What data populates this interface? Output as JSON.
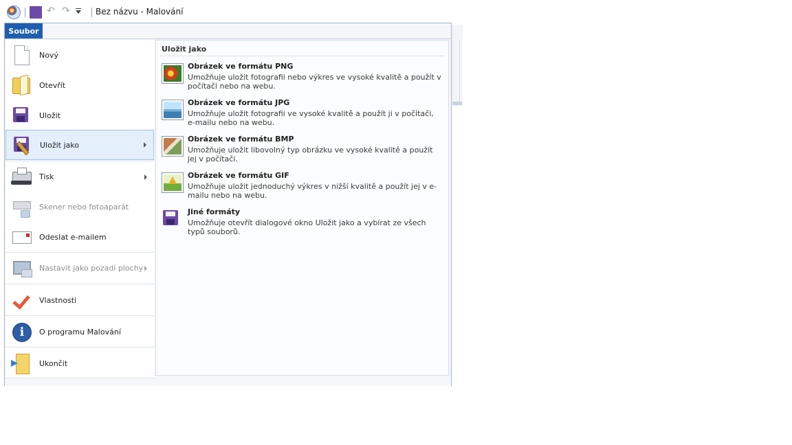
{
  "window": {
    "title": "Bez názvu - Malování"
  },
  "quick_access": {
    "icons": [
      "paint-app-icon",
      "save-icon",
      "undo-icon",
      "redo-icon",
      "customize-dropdown-icon"
    ]
  },
  "ribbon": {
    "file_tab_label": "Soubor",
    "accent_color": "#1f5fb0"
  },
  "file_menu": {
    "items": [
      {
        "label": "Nový",
        "icon": "new-document-icon",
        "enabled": true
      },
      {
        "label": "Otevřít",
        "icon": "open-folder-icon",
        "enabled": true
      },
      {
        "label": "Uložit",
        "icon": "save-icon",
        "enabled": true
      },
      {
        "label": "Uložit jako",
        "icon": "save-as-icon",
        "enabled": true,
        "selected": true,
        "has_submenu": true
      },
      {
        "label": "Tisk",
        "icon": "printer-icon",
        "enabled": true,
        "has_submenu": true
      },
      {
        "label": "Skener nebo fotoaparát",
        "icon": "scanner-icon",
        "enabled": false
      },
      {
        "label": "Odeslat e-mailem",
        "icon": "email-icon",
        "enabled": true
      },
      {
        "label": "Nastavit jako pozadí plochy",
        "icon": "desktop-background-icon",
        "enabled": false,
        "has_submenu": true
      },
      {
        "label": "Vlastnosti",
        "icon": "checkmark-icon",
        "enabled": true
      },
      {
        "label": "O programu Malování",
        "icon": "info-icon",
        "enabled": true
      },
      {
        "label": "Ukončit",
        "icon": "exit-icon",
        "enabled": true
      }
    ]
  },
  "save_as_panel": {
    "heading": "Uložit jako",
    "options": [
      {
        "title": "Obrázek ve formátu PNG",
        "description": "Umožňuje uložit fotografii nebo výkres ve vysoké kvalitě a použít v počítači nebo na webu.",
        "icon": "png-image-icon"
      },
      {
        "title": "Obrázek ve formátu JPG",
        "description": "Umožňuje uložit fotografii ve vysoké kvalitě a použít ji v počítači, e-mailu nebo na webu.",
        "icon": "jpg-image-icon"
      },
      {
        "title": "Obrázek ve formátu BMP",
        "description": "Umožňuje uložit libovolný typ obrázku ve vysoké kvalitě a použít jej v počítači.",
        "icon": "bmp-image-icon"
      },
      {
        "title": "Obrázek ve formátu GIF",
        "description": "Umožňuje uložit jednoduchý výkres v nižší kvalitě a použít jej v e-mailu nebo na webu.",
        "icon": "gif-image-icon"
      },
      {
        "title": "Jiné formáty",
        "description": "Umožňuje otevřít dialogové okno Uložit jako a vybírat ze všech typů souborů.",
        "icon": "other-formats-icon"
      }
    ]
  }
}
